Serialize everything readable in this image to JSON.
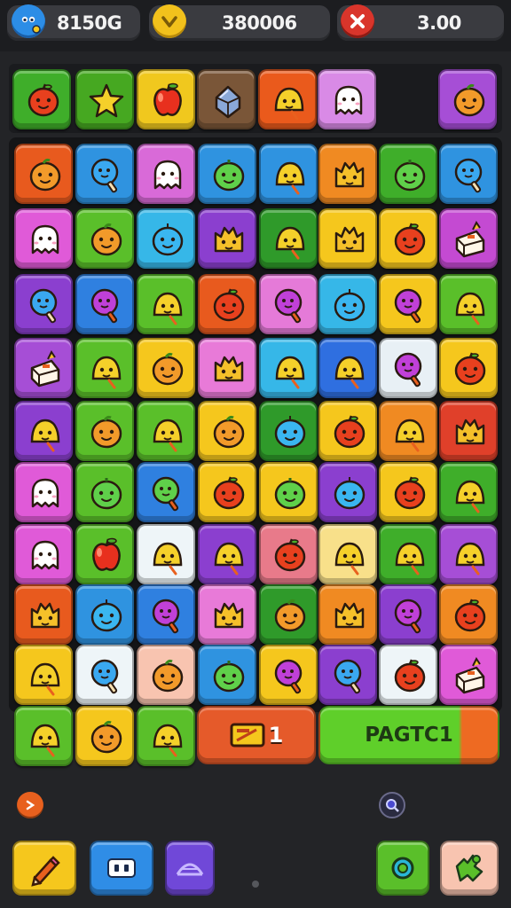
{
  "hud": {
    "coins": {
      "value": "8150G",
      "icon": "blue-blob-icon",
      "color": "#2c8de6"
    },
    "score": {
      "value": "380006",
      "icon": "yellow-chevron-icon",
      "color": "#f2c11c"
    },
    "timer": {
      "value": "3.00",
      "icon": "red-x-icon",
      "color": "#d9352b"
    }
  },
  "targets": [
    {
      "color": "#3fae2a",
      "icon": "apple-face"
    },
    {
      "color": "#46a821",
      "icon": "star"
    },
    {
      "color": "#f0c81e",
      "icon": "apple"
    },
    {
      "color": "#7a5638",
      "icon": "gem"
    },
    {
      "color": "#ea5a1c",
      "icon": "bell-face"
    },
    {
      "color": "#d98ae6",
      "icon": "ghost"
    },
    {
      "color": "#a64ed6",
      "icon": "orange-face"
    }
  ],
  "board": {
    "rows": [
      [
        {
          "color": "#e85a1e",
          "icon": "orange-face"
        },
        {
          "color": "#2f93e0",
          "icon": "blue-pop"
        },
        {
          "color": "#d96ad8",
          "icon": "ghost"
        },
        {
          "color": "#2f93e0",
          "icon": "green-face"
        },
        {
          "color": "#2f93e0",
          "icon": "bell-face"
        },
        {
          "color": "#f08a22",
          "icon": "cat-face"
        },
        {
          "color": "#3fae2a",
          "icon": "green-face"
        },
        {
          "color": "#2f93e0",
          "icon": "blue-pop"
        }
      ],
      [
        {
          "color": "#e05ad8",
          "icon": "ghost"
        },
        {
          "color": "#5abf2a",
          "icon": "orange-face"
        },
        {
          "color": "#36b7e8",
          "icon": "blue-face"
        },
        {
          "color": "#8b3fcf",
          "icon": "cat-face"
        },
        {
          "color": "#2f9a2a",
          "icon": "bell-face"
        },
        {
          "color": "#f5c71d",
          "icon": "cat-face"
        },
        {
          "color": "#f5c71d",
          "icon": "apple-face"
        },
        {
          "color": "#c44ad2",
          "icon": "cake"
        }
      ],
      [
        {
          "color": "#8b3fcf",
          "icon": "blue-pop"
        },
        {
          "color": "#2f80e0",
          "icon": "purple-pop"
        },
        {
          "color": "#5abf2a",
          "icon": "bell-face"
        },
        {
          "color": "#e85a1e",
          "icon": "apple-face"
        },
        {
          "color": "#e57ad8",
          "icon": "purple-pop"
        },
        {
          "color": "#36b7e8",
          "icon": "blue-face"
        },
        {
          "color": "#f5c71d",
          "icon": "purple-pop"
        },
        {
          "color": "#5abf2a",
          "icon": "bell-face"
        }
      ],
      [
        {
          "color": "#a64ed6",
          "icon": "cake"
        },
        {
          "color": "#5abf2a",
          "icon": "bell-face"
        },
        {
          "color": "#f5c71d",
          "icon": "orange-face"
        },
        {
          "color": "#e87ad8",
          "icon": "cat-face"
        },
        {
          "color": "#36b7e8",
          "icon": "bell-face"
        },
        {
          "color": "#2f6fe0",
          "icon": "bell-face"
        },
        {
          "color": "#e8f0f5",
          "icon": "purple-pop"
        },
        {
          "color": "#f5c71d",
          "icon": "apple-face"
        }
      ],
      [
        {
          "color": "#8b3fcf",
          "icon": "bell-face"
        },
        {
          "color": "#5abf2a",
          "icon": "orange-face"
        },
        {
          "color": "#5abf2a",
          "icon": "bell-face"
        },
        {
          "color": "#f5c71d",
          "icon": "orange-face"
        },
        {
          "color": "#2f9a2a",
          "icon": "blue-face"
        },
        {
          "color": "#f5c71d",
          "icon": "apple-face"
        },
        {
          "color": "#f08a22",
          "icon": "bell-face"
        },
        {
          "color": "#e0402a",
          "icon": "cat-face"
        }
      ],
      [
        {
          "color": "#e05ad8",
          "icon": "ghost"
        },
        {
          "color": "#5abf2a",
          "icon": "green-face"
        },
        {
          "color": "#2f80e0",
          "icon": "green-pop"
        },
        {
          "color": "#f5c71d",
          "icon": "apple-face"
        },
        {
          "color": "#f5c71d",
          "icon": "green-face"
        },
        {
          "color": "#8b3fcf",
          "icon": "blue-face"
        },
        {
          "color": "#f5c71d",
          "icon": "apple-face"
        },
        {
          "color": "#3fae2a",
          "icon": "bell-face"
        }
      ],
      [
        {
          "color": "#e05ad8",
          "icon": "ghost"
        },
        {
          "color": "#5abf2a",
          "icon": "apple"
        },
        {
          "color": "#eef5f8",
          "icon": "bell-face"
        },
        {
          "color": "#8b3fcf",
          "icon": "bell-face"
        },
        {
          "color": "#e87a8a",
          "icon": "apple-face"
        },
        {
          "color": "#f8e08a",
          "icon": "bell-face"
        },
        {
          "color": "#3fae2a",
          "icon": "bell-face"
        },
        {
          "color": "#a64ed6",
          "icon": "bell-face"
        }
      ],
      [
        {
          "color": "#e85a1e",
          "icon": "cat-face"
        },
        {
          "color": "#2f93e0",
          "icon": "blue-face"
        },
        {
          "color": "#2f80e0",
          "icon": "purple-pop"
        },
        {
          "color": "#e87ad8",
          "icon": "cat-face"
        },
        {
          "color": "#2f9a2a",
          "icon": "orange-face"
        },
        {
          "color": "#f08a22",
          "icon": "cat-face"
        },
        {
          "color": "#8b3fcf",
          "icon": "purple-pop"
        },
        {
          "color": "#f08a22",
          "icon": "apple-face"
        }
      ],
      [
        {
          "color": "#f5c71d",
          "icon": "bell-face"
        },
        {
          "color": "#eef5f8",
          "icon": "blue-pop"
        },
        {
          "color": "#f8c4b0",
          "icon": "orange-face"
        },
        {
          "color": "#2f93e0",
          "icon": "green-face"
        },
        {
          "color": "#f5c71d",
          "icon": "purple-pop"
        },
        {
          "color": "#8b3fcf",
          "icon": "blue-pop"
        },
        {
          "color": "#eef5f8",
          "icon": "apple-face"
        },
        {
          "color": "#e05ad8",
          "icon": "cake"
        }
      ]
    ],
    "bottom_row": [
      {
        "color": "#5abf2a",
        "icon": "bell-face"
      },
      {
        "color": "#f5c71d",
        "icon": "orange-face"
      },
      {
        "color": "#5abf2a",
        "icon": "bell-face"
      }
    ]
  },
  "move_counter": {
    "label": "1",
    "icon": "ticket-icon",
    "color": "#e55a2a"
  },
  "progress_button": {
    "label": "PAGTC1",
    "color": "#5fcf2a",
    "accent": "#ee6a22"
  },
  "tools": [
    {
      "name": "pencil-tool",
      "color": "#f5c71d",
      "icon": "pencil-icon"
    },
    {
      "name": "eyes-tool",
      "color": "#2f8de6",
      "icon": "eyes-icon"
    },
    {
      "name": "dome-tool",
      "color": "#7048d8",
      "icon": "dome-icon"
    },
    {
      "name": "ring-tool",
      "color": "#5abf2a",
      "icon": "ring-icon"
    },
    {
      "name": "puzzle-tool",
      "color": "#f8c4b0",
      "icon": "puzzle-icon"
    }
  ]
}
